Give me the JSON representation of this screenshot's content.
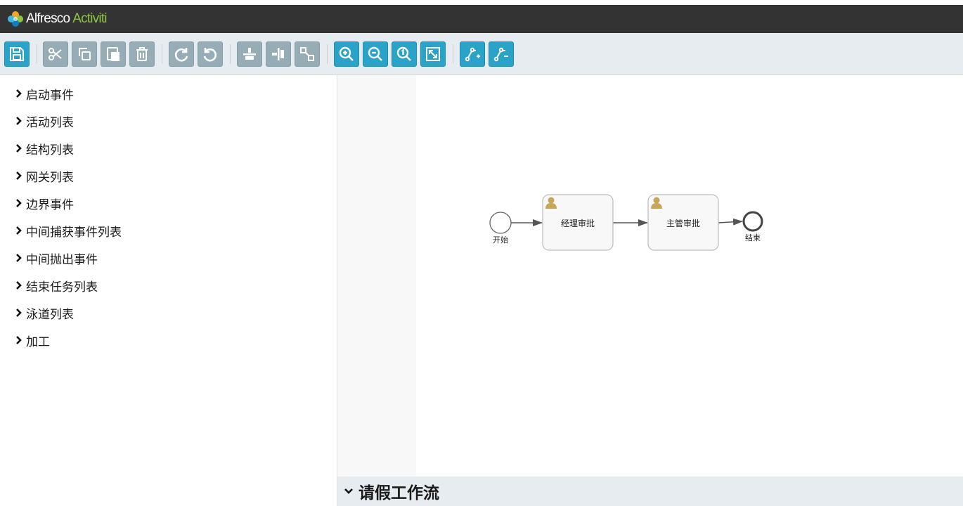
{
  "header": {
    "brand_part1": "Alfresco",
    "brand_part2": "Activiti",
    "bg_color": "#333333",
    "brand_accent": "#8cc63f"
  },
  "toolbar": {
    "buttons": [
      {
        "name": "save-button",
        "icon": "save-icon",
        "style": "blue"
      },
      {
        "name": "cut-button",
        "icon": "scissors-icon",
        "style": "gray"
      },
      {
        "name": "copy-button",
        "icon": "copy-icon",
        "style": "gray"
      },
      {
        "name": "paste-button",
        "icon": "paste-icon",
        "style": "gray"
      },
      {
        "name": "delete-button",
        "icon": "trash-icon",
        "style": "gray"
      },
      {
        "name": "redo-button",
        "icon": "redo-icon",
        "style": "gray"
      },
      {
        "name": "undo-button",
        "icon": "undo-icon",
        "style": "gray"
      },
      {
        "name": "align-horizontal-button",
        "icon": "align-horizontal-icon",
        "style": "gray"
      },
      {
        "name": "align-vertical-button",
        "icon": "align-vertical-icon",
        "style": "gray"
      },
      {
        "name": "same-size-button",
        "icon": "same-size-icon",
        "style": "gray"
      },
      {
        "name": "zoom-in-button",
        "icon": "zoom-in-icon",
        "style": "blue"
      },
      {
        "name": "zoom-out-button",
        "icon": "zoom-out-icon",
        "style": "blue"
      },
      {
        "name": "zoom-actual-button",
        "icon": "zoom-actual-icon",
        "style": "blue"
      },
      {
        "name": "zoom-fit-button",
        "icon": "zoom-fit-icon",
        "style": "blue"
      },
      {
        "name": "add-bendpoint-button",
        "icon": "add-bendpoint-icon",
        "style": "blue"
      },
      {
        "name": "remove-bendpoint-button",
        "icon": "remove-bendpoint-icon",
        "style": "blue"
      }
    ],
    "colors": {
      "blue": "#29a3c8",
      "gray": "#96adb6"
    }
  },
  "sidebar": {
    "items": [
      {
        "label": "启动事件"
      },
      {
        "label": "活动列表"
      },
      {
        "label": "结构列表"
      },
      {
        "label": "网关列表"
      },
      {
        "label": "边界事件"
      },
      {
        "label": "中间捕获事件列表"
      },
      {
        "label": "中间抛出事件"
      },
      {
        "label": "结束任务列表"
      },
      {
        "label": "泳道列表"
      },
      {
        "label": "加工"
      }
    ]
  },
  "diagram": {
    "start_event_label": "开始",
    "task1_label": "经理审批",
    "task2_label": "主管审批",
    "end_event_label": "结束",
    "user_icon_color": "#c9a55a",
    "task_fill": "#f8f8f8",
    "task_stroke": "#bbbbbb"
  },
  "bottom_panel": {
    "title": "请假工作流"
  }
}
